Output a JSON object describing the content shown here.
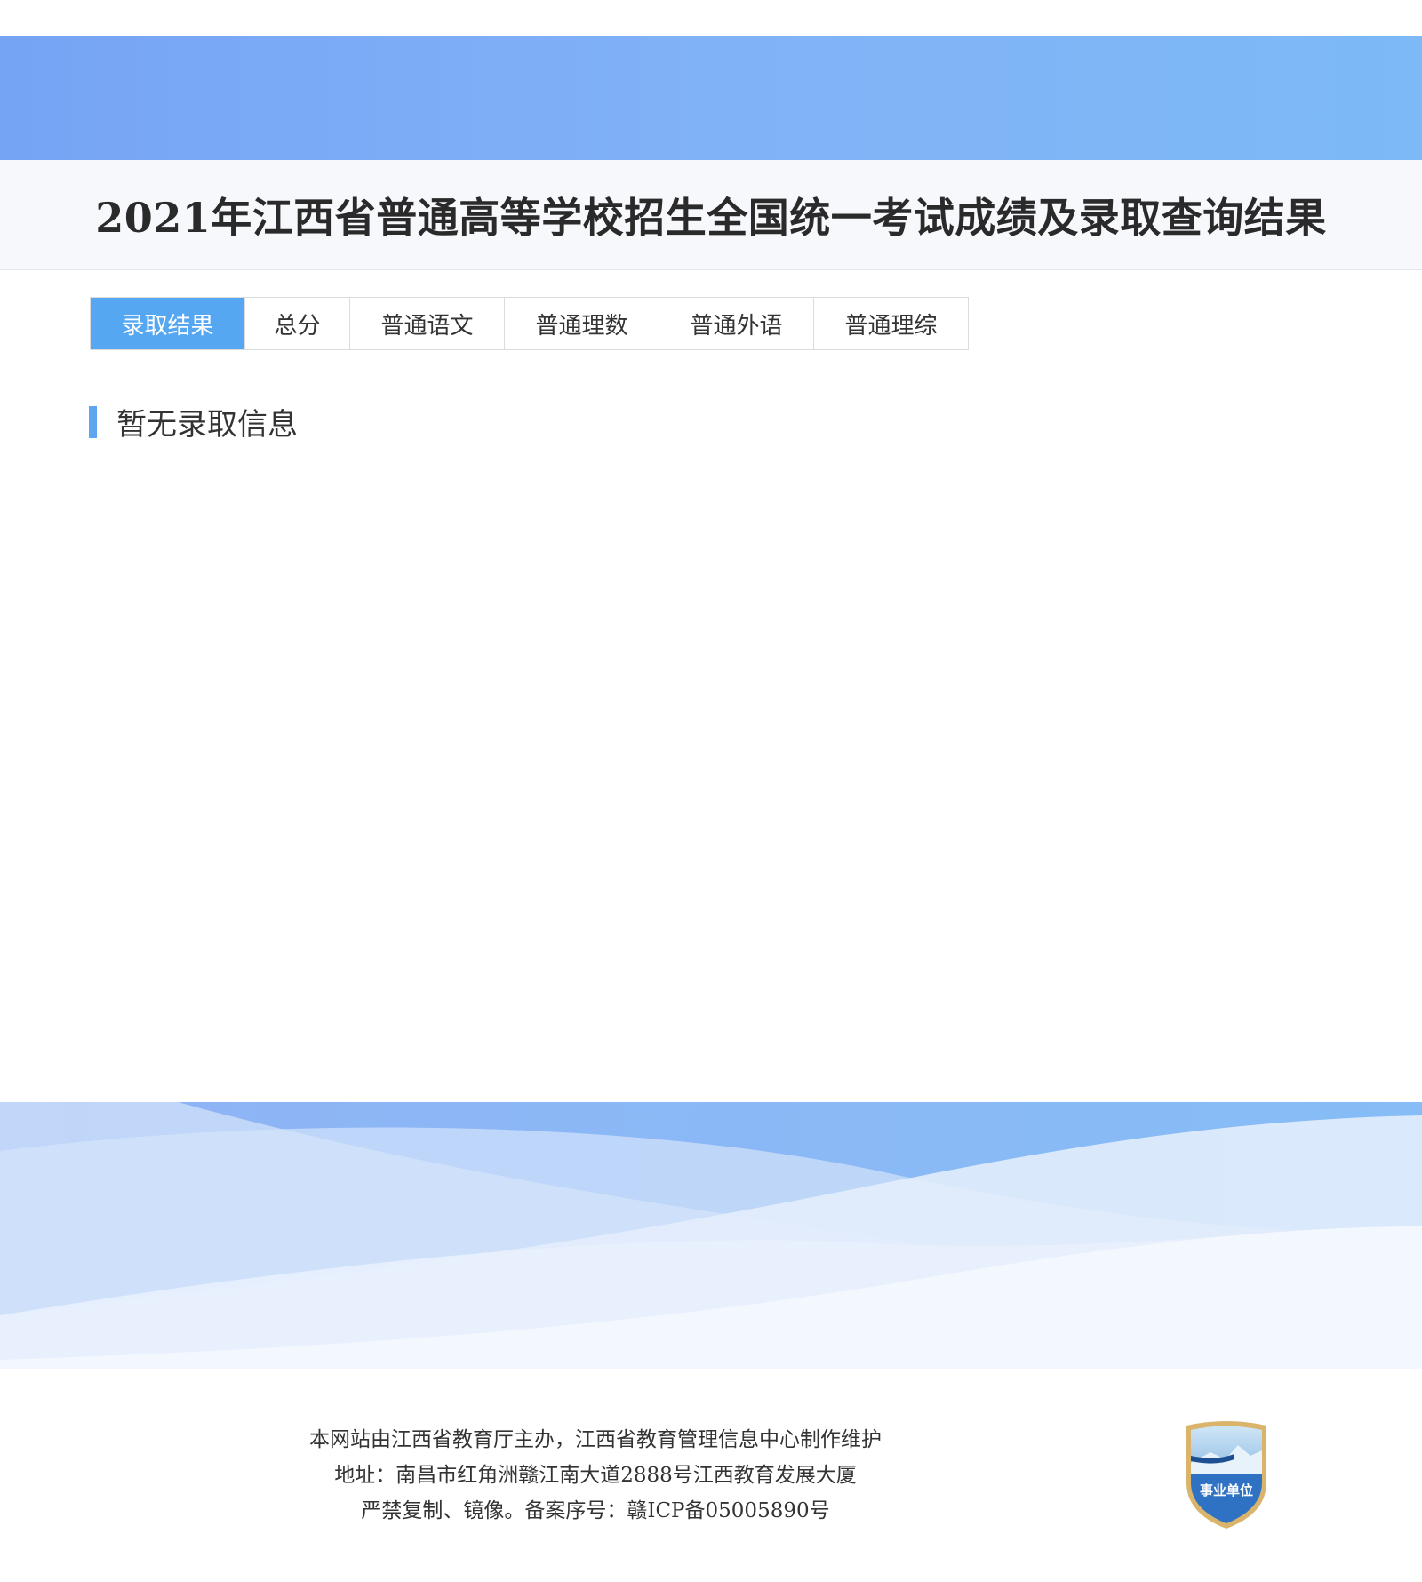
{
  "page_title": "2021年江西省普通高等学校招生全国统一考试成绩及录取查询结果",
  "tabs": [
    {
      "label": "录取结果",
      "active": true
    },
    {
      "label": "总分",
      "active": false
    },
    {
      "label": "普通语文",
      "active": false
    },
    {
      "label": "普通理数",
      "active": false
    },
    {
      "label": "普通外语",
      "active": false
    },
    {
      "label": "普通理综",
      "active": false
    }
  ],
  "section": {
    "heading": "暂无录取信息"
  },
  "footer": {
    "line1": "本网站由江西省教育厅主办，江西省教育管理信息中心制作维护",
    "line2": "地址：南昌市红角洲赣江南大道2888号江西教育发展大厦",
    "line3": "严禁复制、镜像。备案序号：赣ICP备05005890号"
  },
  "badge": {
    "label": "事业单位",
    "icon": "government-institution-badge-icon"
  },
  "colors": {
    "accent": "#56a7f2",
    "banner": "#7eb0f6",
    "title_bg": "#f7f8fc"
  }
}
